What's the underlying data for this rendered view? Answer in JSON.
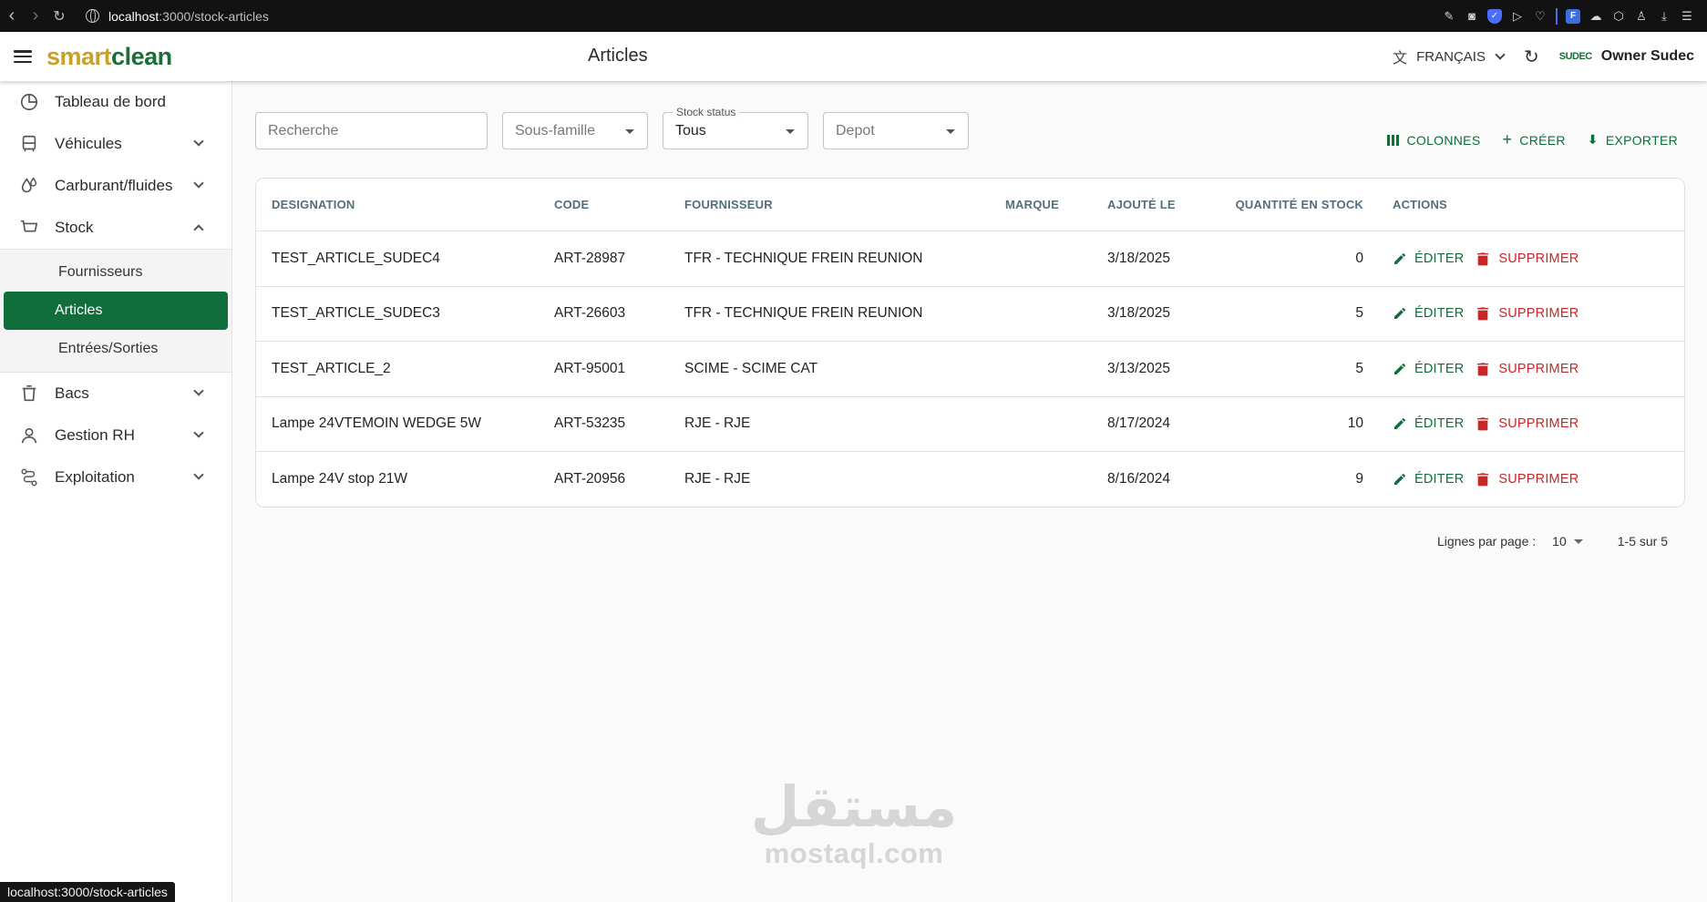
{
  "browser": {
    "url_host": "localhost",
    "url_path": ":3000/stock-articles",
    "status_url": "localhost:3000/stock-articles"
  },
  "header": {
    "logo_smart": "smart",
    "logo_clean": "clean",
    "title": "Articles",
    "language": "FRANÇAIS",
    "company_logo": "SUDEC",
    "user": "Owner Sudec"
  },
  "sidebar": {
    "items": [
      {
        "label": "Tableau de bord",
        "icon": "pie-chart-icon"
      },
      {
        "label": "Véhicules",
        "icon": "bus-icon"
      },
      {
        "label": "Carburant/fluides",
        "icon": "droplet-icon"
      },
      {
        "label": "Stock",
        "icon": "cart-icon"
      },
      {
        "label": "Bacs",
        "icon": "bin-icon"
      },
      {
        "label": "Gestion RH",
        "icon": "person-icon"
      },
      {
        "label": "Exploitation",
        "icon": "route-icon"
      }
    ],
    "stock_sub": [
      {
        "label": "Fournisseurs"
      },
      {
        "label": "Articles"
      },
      {
        "label": "Entrées/Sorties"
      }
    ]
  },
  "filters": {
    "search_placeholder": "Recherche",
    "sous_famille": "Sous-famille",
    "stock_status_label": "Stock status",
    "stock_status_value": "Tous",
    "depot": "Depot"
  },
  "toolbar": {
    "colonnes": "COLONNES",
    "creer": "CRÉER",
    "exporter": "EXPORTER"
  },
  "table": {
    "headers": {
      "designation": "DESIGNATION",
      "code": "CODE",
      "fournisseur": "FOURNISSEUR",
      "marque": "MARQUE",
      "ajoute_le": "AJOUTÉ LE",
      "quantite": "QUANTITÉ EN STOCK",
      "actions": "ACTIONS"
    },
    "edit_label": "ÉDITER",
    "delete_label": "SUPPRIMER",
    "rows": [
      {
        "designation": "TEST_ARTICLE_SUDEC4",
        "code": "ART-28987",
        "fournisseur": "TFR - TECHNIQUE FREIN REUNION",
        "marque": "",
        "date": "3/18/2025",
        "qty": "0"
      },
      {
        "designation": "TEST_ARTICLE_SUDEC3",
        "code": "ART-26603",
        "fournisseur": "TFR - TECHNIQUE FREIN REUNION",
        "marque": "",
        "date": "3/18/2025",
        "qty": "5"
      },
      {
        "designation": "TEST_ARTICLE_2",
        "code": "ART-95001",
        "fournisseur": "SCIME - SCIME CAT",
        "marque": "",
        "date": "3/13/2025",
        "qty": "5"
      },
      {
        "designation": "Lampe 24VTEMOIN WEDGE 5W",
        "code": "ART-53235",
        "fournisseur": "RJE - RJE",
        "marque": "",
        "date": "8/17/2024",
        "qty": "10"
      },
      {
        "designation": "Lampe 24V stop 21W",
        "code": "ART-20956",
        "fournisseur": "RJE - RJE",
        "marque": "",
        "date": "8/16/2024",
        "qty": "9"
      }
    ]
  },
  "pagination": {
    "rows_per_page_label": "Lignes par page :",
    "rows_per_page": "10",
    "range": "1-5 sur 5"
  },
  "watermark": {
    "arabic": "مستقل",
    "latin": "mostaql.com"
  },
  "colors": {
    "primary": "#0f6e3a",
    "danger": "#c62828",
    "logo_gold": "#c8a12a"
  }
}
